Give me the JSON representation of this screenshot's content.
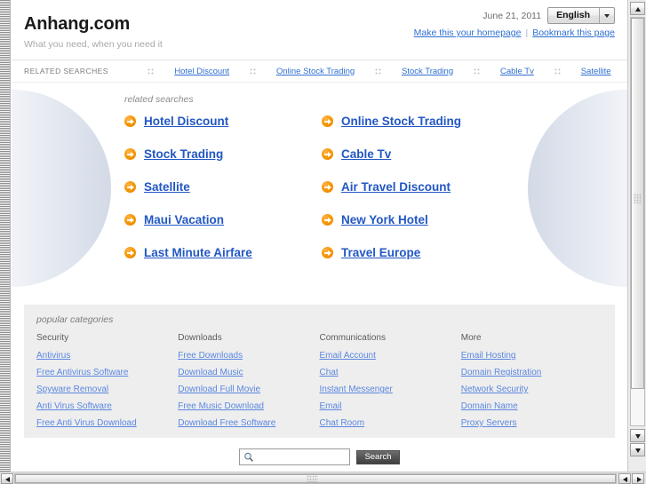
{
  "header": {
    "brand": "Anhang.com",
    "tagline": "What you need, when you need it",
    "date": "June 21, 2011",
    "language": "English",
    "language_caret": "chevron-down-icon",
    "homepage_link": "Make this your homepage",
    "separator": "|",
    "bookmark_link": "Bookmark this page"
  },
  "related_bar": {
    "label": "RELATED SEARCHES",
    "links": [
      "Hotel Discount",
      "Online Stock Trading",
      "Stock Trading",
      "Cable Tv",
      "Satellite"
    ]
  },
  "main": {
    "caption": "related searches",
    "links": [
      "Hotel Discount",
      "Online Stock Trading",
      "Stock Trading",
      "Cable Tv",
      "Satellite",
      "Air Travel Discount",
      "Maui Vacation",
      "New York Hotel",
      "Last Minute Airfare",
      "Travel Europe"
    ]
  },
  "popular": {
    "caption": "popular categories",
    "columns": [
      {
        "heading": "Security",
        "links": [
          "Antivirus",
          "Free Antivirus Software",
          "Spyware Removal",
          "Anti Virus Software",
          "Free Anti Virus Download"
        ]
      },
      {
        "heading": "Downloads",
        "links": [
          "Free Downloads",
          "Download Music",
          "Download Full Movie",
          "Free Music Download",
          "Download Free Software"
        ]
      },
      {
        "heading": "Communications",
        "links": [
          "Email Account",
          "Chat",
          "Instant Messenger",
          "Email",
          "Chat Room"
        ]
      },
      {
        "heading": "More",
        "links": [
          "Email Hosting",
          "Domain Registration",
          "Network Security",
          "Domain Name",
          "Proxy Servers"
        ]
      }
    ]
  },
  "search": {
    "value": "",
    "placeholder": "",
    "icon": "magnifier-icon",
    "button_label": "Search"
  },
  "colors": {
    "link_blue": "#2f6fd0",
    "main_link_blue": "#2257c4",
    "category_link_blue": "#5b87e0",
    "bullet_orange": "#f59400",
    "panel_gray": "#eeeeee",
    "button_dark": "#525252"
  }
}
